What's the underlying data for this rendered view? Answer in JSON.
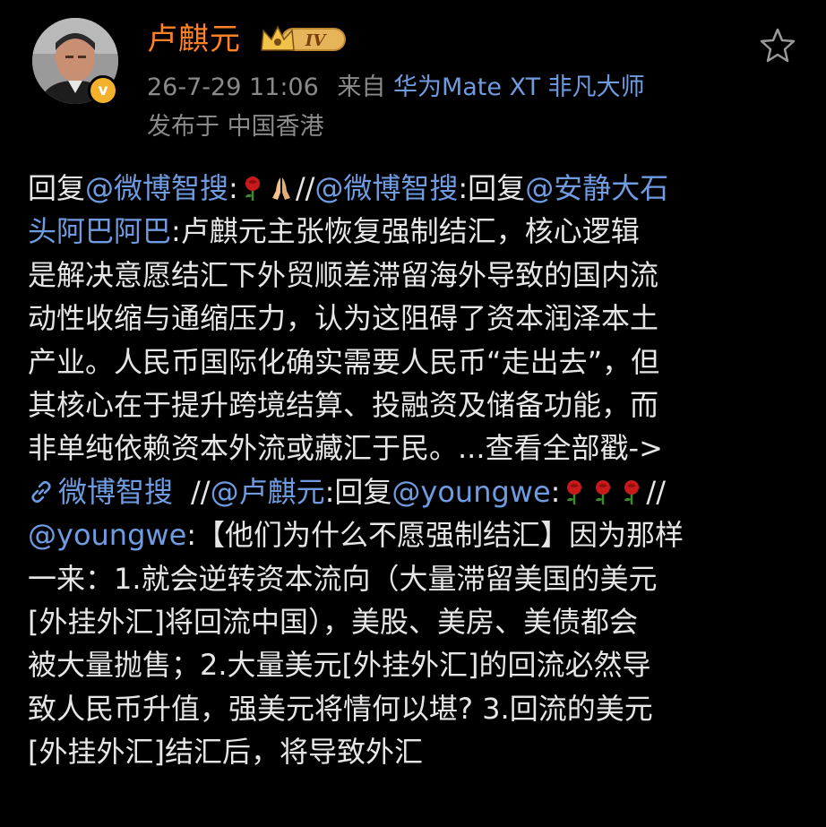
{
  "header": {
    "username": "卢麒元",
    "badge_avatar": "v",
    "vip_level": "IV",
    "timestamp": "26-7-29 11:06",
    "source_prefix": "来自",
    "source": "华为Mate XT 非凡大师",
    "location": "发布于 中国香港",
    "favorite_icon": "star-outline-icon"
  },
  "colors": {
    "background": "#000000",
    "username": "#ff8226",
    "link": "#6f9ce0",
    "meta": "#8a8a8a",
    "text": "#e6e6e6"
  },
  "post": {
    "l1_a": "回复",
    "l1_mention1": "@微博智搜",
    "l1_b": ":",
    "l1_c": "//",
    "l1_mention2": "@微博智搜",
    "l1_d": ":回复",
    "l1_mention3a": "@安静大石",
    "l2_mention3b": "头阿巴阿巴",
    "l2_text": ":卢麒元主张恢复强制结汇，核心逻辑",
    "l3": "是解决意愿结汇下外贸顺差滞留海外导致的国内流",
    "l4": "动性收缩与通缩压力，认为这阻碍了资本润泽本土",
    "l5": "产业。人民币国际化确实需要人民币“走出去”，但",
    "l6": "其核心在于提升跨境结算、投融资及储备功能，而",
    "l7": "非单纯依赖资本外流或藏汇于民。...查看全部戳->",
    "l8_link": "微博智搜",
    "l8_a": "//",
    "l8_mention": "@卢麒元",
    "l8_b": ":回复",
    "l8_mention2": "@youngwe",
    "l8_c": ":",
    "l8_d": "//",
    "l9_mention": "@youngwe",
    "l9_text": ":【他们为什么不愿强制结汇】因为那样",
    "l10": "一来：1.就会逆转资本流向（大量滞留美国的美元",
    "l11": "[外挂外汇]将回流中国），美股、美房、美债都会",
    "l12": "被大量抛售；2.大量美元[外挂外汇]的回流必然导",
    "l13": "致人民币升值，强美元将情何以堪? 3.回流的美元",
    "l14": "[外挂外汇]结汇后，将导致外汇"
  }
}
